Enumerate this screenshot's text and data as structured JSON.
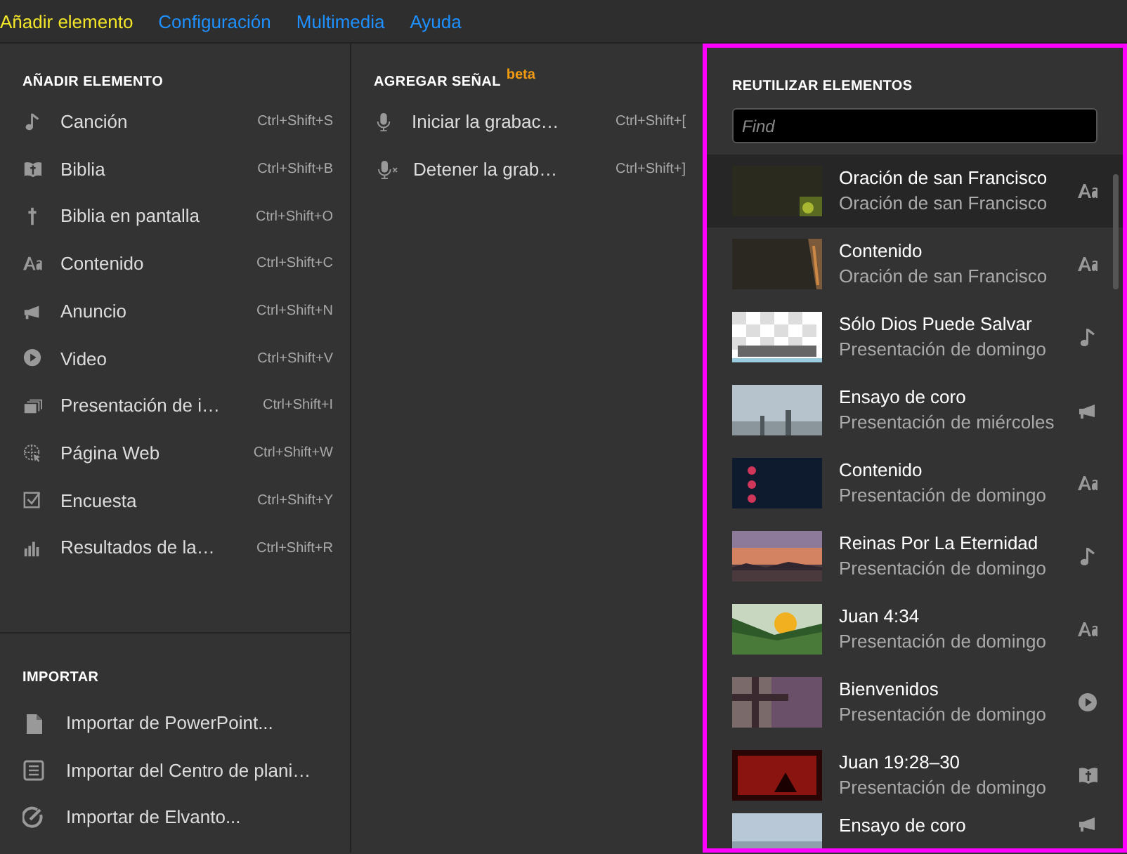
{
  "menu": [
    {
      "label": "Añadir elemento",
      "selected": true
    },
    {
      "label": "Configuración",
      "selected": false
    },
    {
      "label": "Multimedia",
      "selected": false
    },
    {
      "label": "Ayuda",
      "selected": false
    }
  ],
  "add_items": {
    "heading": "AÑADIR ELEMENTO",
    "items": [
      {
        "kind": "song",
        "label": "Canción",
        "shortcut": "Ctrl+Shift+S"
      },
      {
        "kind": "bible",
        "label": "Biblia",
        "shortcut": "Ctrl+Shift+B"
      },
      {
        "kind": "cross",
        "label": "Biblia en pantalla",
        "shortcut": "Ctrl+Shift+O"
      },
      {
        "kind": "text",
        "label": "Contenido",
        "shortcut": "Ctrl+Shift+C"
      },
      {
        "kind": "megaphone",
        "label": "Anuncio",
        "shortcut": "Ctrl+Shift+N"
      },
      {
        "kind": "video",
        "label": "Video",
        "shortcut": "Ctrl+Shift+V"
      },
      {
        "kind": "slides",
        "label": "Presentación de i…",
        "shortcut": "Ctrl+Shift+I"
      },
      {
        "kind": "web",
        "label": "Página Web",
        "shortcut": "Ctrl+Shift+W"
      },
      {
        "kind": "poll",
        "label": "Encuesta",
        "shortcut": "Ctrl+Shift+Y"
      },
      {
        "kind": "results",
        "label": "Resultados de la…",
        "shortcut": "Ctrl+Shift+R"
      }
    ]
  },
  "import": {
    "heading": "IMPORTAR",
    "items": [
      {
        "kind": "file",
        "label": "Importar de PowerPoint..."
      },
      {
        "kind": "document",
        "label": "Importar del Centro de plani…"
      },
      {
        "kind": "check",
        "label": "Importar de Elvanto..."
      }
    ]
  },
  "cues": {
    "heading": "AGREGAR SEÑAL",
    "badge": "beta",
    "items": [
      {
        "kind": "mic",
        "label": "Iniciar la grabac…",
        "shortcut": "Ctrl+Shift+["
      },
      {
        "kind": "mic-off",
        "label": "Detener la grab…",
        "shortcut": "Ctrl+Shift+]"
      }
    ]
  },
  "reuse": {
    "heading": "REUTILIZAR ELEMENTOS",
    "search": {
      "placeholder": "Find"
    },
    "items": [
      {
        "title": "Oración de san Francisco",
        "subtitle": "Oración de san Francisco",
        "kind": "text",
        "selected": true
      },
      {
        "title": "Contenido",
        "subtitle": "Oración de san Francisco",
        "kind": "text",
        "selected": false
      },
      {
        "title": "Sólo Dios Puede Salvar",
        "subtitle": "Presentación de domingo",
        "kind": "song",
        "selected": false
      },
      {
        "title": "Ensayo de coro",
        "subtitle": "Presentación de miércoles",
        "kind": "megaphone",
        "selected": false
      },
      {
        "title": "Contenido",
        "subtitle": "Presentación de domingo",
        "kind": "text",
        "selected": false
      },
      {
        "title": "Reinas Por La Eternidad",
        "subtitle": "Presentación de domingo",
        "kind": "song",
        "selected": false
      },
      {
        "title": "Juan 4:34",
        "subtitle": "Presentación de domingo",
        "kind": "text",
        "selected": false
      },
      {
        "title": "Bienvenidos",
        "subtitle": "Presentación de domingo",
        "kind": "video",
        "selected": false
      },
      {
        "title": "Juan 19:28–30",
        "subtitle": "Presentación de domingo",
        "kind": "bible",
        "selected": false
      },
      {
        "title": "Ensayo de coro",
        "kind": "megaphone",
        "selected": false
      }
    ]
  }
}
